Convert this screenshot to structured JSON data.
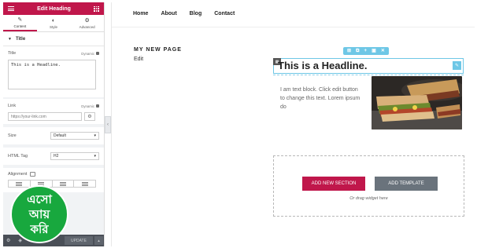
{
  "panel": {
    "title": "Edit Heading",
    "tabs": [
      {
        "label": "Content",
        "icon": "pencil-icon",
        "glyph": "✎"
      },
      {
        "label": "Style",
        "icon": "contrast-icon",
        "glyph": "◐"
      },
      {
        "label": "Advanced",
        "icon": "gear-icon",
        "glyph": "⚙"
      }
    ],
    "section_title": "Title",
    "title_label": "Title",
    "dynamic_label": "Dynamic",
    "title_value": "This is a Headline.",
    "link_label": "Link",
    "link_placeholder": "https://your-link.com",
    "size_label": "Size",
    "size_value": "Default",
    "html_tag_label": "HTML Tag",
    "html_tag_value": "H2",
    "alignment_label": "Alignment",
    "update_label": "UPDATE"
  },
  "watermark": {
    "line1": "এসো",
    "line2": "আয়",
    "line3": "করি",
    "color": "#18a83e"
  },
  "preview": {
    "nav": [
      "Home",
      "About",
      "Blog",
      "Contact"
    ],
    "page_title": "MY NEW PAGE",
    "edit_link": "Edit",
    "headline": "This is a Headline.",
    "text_block": "I am text block. Click edit button to change this text. Lorem ipsum do",
    "add_section_label": "ADD NEW SECTION",
    "add_template_label": "ADD TEMPLATE",
    "drag_hint": "Or drag widget here"
  },
  "colors": {
    "accent": "#c0174b",
    "selection": "#6ec7e6",
    "panel_footer": "#4a4f57"
  }
}
